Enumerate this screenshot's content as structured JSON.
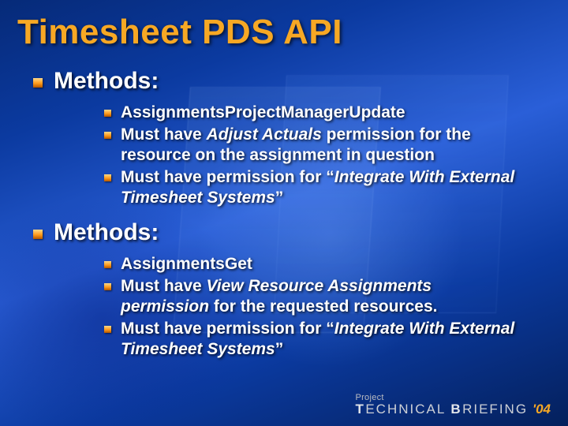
{
  "title": "Timesheet PDS API",
  "sections": [
    {
      "label": "Methods:",
      "items": [
        {
          "html": "AssignmentsProjectManagerUpdate"
        },
        {
          "html": "Must have <em>Adjust Actuals</em> permission for the resource on the assignment in question"
        },
        {
          "html": "Must have permission for &ldquo;<em>Integrate With External Timesheet Systems</em>&rdquo;"
        }
      ]
    },
    {
      "label": "Methods:",
      "items": [
        {
          "html": "AssignmentsGet"
        },
        {
          "html": "Must have <em>View Resource Assignments permission</em> for the requested resources."
        },
        {
          "html": "Must have permission for &ldquo;<em>Integrate With External Timesheet Systems</em>&rdquo;"
        }
      ]
    }
  ],
  "footer": {
    "project": "Project",
    "word1": "T",
    "word1rest": "ECHNICAL",
    "word2": "B",
    "word2rest": "RIEFING",
    "year": "'04"
  }
}
